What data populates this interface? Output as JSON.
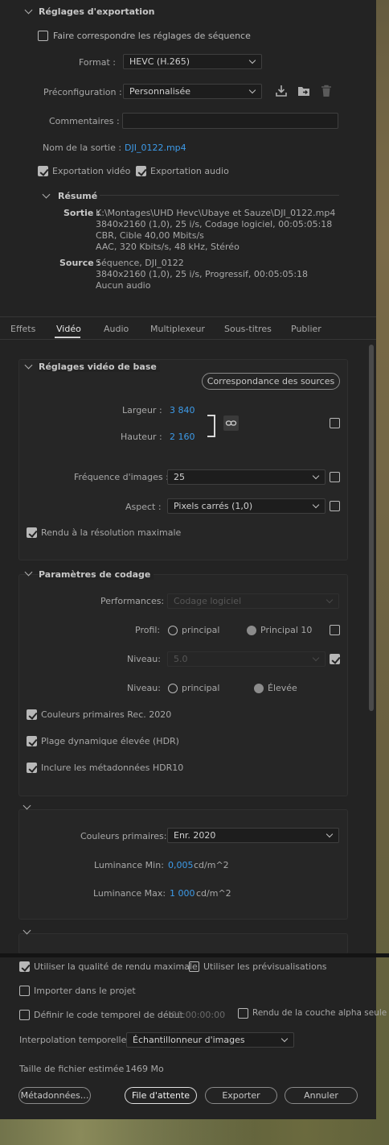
{
  "export_settings": {
    "section_title": "Réglages d'exportation",
    "match_sequence_label": "Faire correspondre les réglages de séquence",
    "format_label": "Format :",
    "format_value": "HEVC (H.265)",
    "preset_label": "Préconfiguration :",
    "preset_value": "Personnalisée",
    "comments_label": "Commentaires :",
    "comments_value": "",
    "output_name_label": "Nom de la sortie :",
    "output_name_value": "DJI_0122.mp4",
    "export_video_label": "Exportation vidéo",
    "export_audio_label": "Exportation audio",
    "summary_title": "Résumé",
    "output_label": "Sortie :",
    "output_lines": [
      "K:\\Montages\\UHD Hevc\\Ubaye et Sauze\\DJI_0122.mp4",
      "3840x2160 (1,0), 25 i/s, Codage logiciel, 00:05:05:18",
      "CBR, Cible 40,00  Mbits/s",
      "AAC, 320  Kbits/s, 48  kHz, Stéréo"
    ],
    "source_label": "Source :",
    "source_lines": [
      "Séquence, DJI_0122",
      "3840x2160 (1,0), 25  i/s, Progressif, 00:05:05:18",
      "Aucun audio"
    ]
  },
  "tabs": [
    "Effets",
    "Vidéo",
    "Audio",
    "Multiplexeur",
    "Sous-titres",
    "Publier"
  ],
  "basic_video": {
    "title": "Réglages vidéo de base",
    "match_source_button": "Correspondance des sources",
    "width_label": "Largeur :",
    "width_value": "3 840",
    "height_label": "Hauteur :",
    "height_value": "2 160",
    "framerate_label": "Fréquence d'images :",
    "framerate_value": "25",
    "aspect_label": "Aspect :",
    "aspect_value": "Pixels carrés (1,0)",
    "max_render_label": "Rendu à la résolution maximale"
  },
  "encoding": {
    "title": "Paramètres de codage",
    "performance_label": "Performances:",
    "performance_value": "Codage logiciel",
    "profile_label": "Profil:",
    "profile_opt1": "principal",
    "profile_opt2": "Principal 10",
    "level_label": "Niveau:",
    "level_value": "5.0",
    "tier_label": "Niveau:",
    "tier_opt1": "principal",
    "tier_opt2": "Élevée",
    "rec2020_label": "Couleurs primaires Rec. 2020",
    "hdr_label": "Plage dynamique élevée (HDR)",
    "hdr10_label": "Inclure les métadonnées HDR10"
  },
  "hdr_meta": {
    "primaries_label": "Couleurs primaires:",
    "primaries_value": "Enr. 2020",
    "lum_min_label": "Luminance Min:",
    "lum_min_value": "0,005",
    "lum_min_unit": "cd/m^2",
    "lum_max_label": "Luminance Max:",
    "lum_max_value": "1 000",
    "lum_max_unit": "cd/m^2"
  },
  "footer": {
    "max_quality_label": "Utiliser la qualité de rendu maximale",
    "use_previews_label": "Utiliser les prévisualisations",
    "import_label": "Importer dans le projet",
    "timecode_label": "Définir le code temporel de début",
    "timecode_value": "00:00:00:00",
    "alpha_label": "Rendu de la couche alpha seule",
    "interp_label": "Interpolation temporelle :",
    "interp_value": "Échantillonneur d'images",
    "filesize_label": "Taille de fichier estimée :",
    "filesize_value": "1469 Mo",
    "metadata_button": "Métadonnées...",
    "queue_button": "File d'attente",
    "export_button": "Exporter",
    "cancel_button": "Annuler"
  }
}
